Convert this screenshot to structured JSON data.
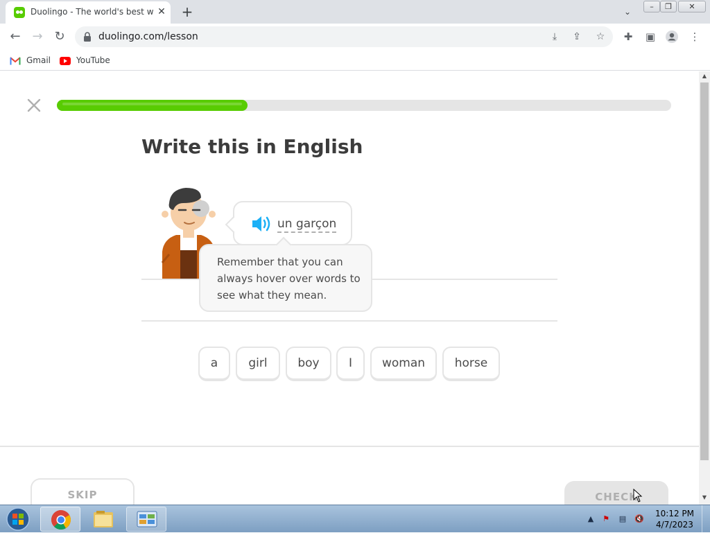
{
  "browser": {
    "tab": {
      "title": "Duolingo - The world's best way to learn",
      "close_icon": "close-icon"
    },
    "new_tab_label": "+",
    "url": "duolingo.com/lesson",
    "bookmarks": [
      {
        "label": "Gmail",
        "icon": "gmail-icon"
      },
      {
        "label": "YouTube",
        "icon": "youtube-icon"
      }
    ]
  },
  "lesson": {
    "progress": 0.31,
    "heading": "Write this in English",
    "prompt_text": "un garçon",
    "tooltip_text": "Remember that you can always hover over words to see what they mean.",
    "word_bank": [
      "a",
      "girl",
      "boy",
      "I",
      "woman",
      "horse"
    ],
    "skip_label": "SKIP",
    "check_label": "CHECK"
  },
  "colors": {
    "accent_green": "#58cc02",
    "progress_track": "#e5e5e5",
    "text_dark": "#3c3c3c",
    "speaker_blue": "#1cb0f6"
  },
  "taskbar": {
    "time": "10:12 PM",
    "date": "4/7/2023"
  }
}
